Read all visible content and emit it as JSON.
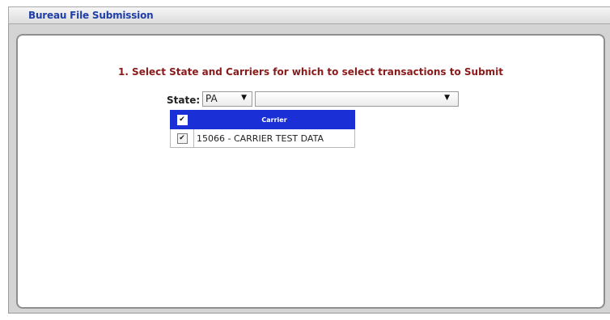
{
  "panel": {
    "title": "Bureau File Submission"
  },
  "step": {
    "instruction": "1. Select State and Carriers for which to select transactions to Submit"
  },
  "state": {
    "label": "State:",
    "selected": "PA",
    "arrow": "▼"
  },
  "carrier_dropdown": {
    "selected": "",
    "arrow": "▼"
  },
  "carrier_table": {
    "header_check": "✔",
    "column": "Carrier",
    "rows": [
      {
        "check": "✔",
        "carrier": "15066 - CARRIER TEST DATA"
      }
    ]
  },
  "colors": {
    "title": "#1f3fa8",
    "instruction": "#8b1a1a",
    "table_header": "#1a2fd6"
  }
}
